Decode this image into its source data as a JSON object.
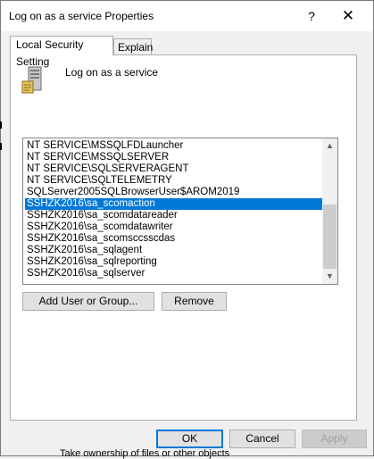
{
  "dialog": {
    "title": "Log on as a service Properties",
    "help_glyph": "?",
    "close_glyph": "✕"
  },
  "tabs": [
    {
      "label": "Local Security Setting",
      "active": true
    },
    {
      "label": "Explain",
      "active": false
    }
  ],
  "policy": {
    "name": "Log on as a service",
    "icon": "server-policy-icon"
  },
  "accounts": {
    "items": [
      "NT SERVICE\\MSSQLFDLauncher",
      "NT SERVICE\\MSSQLSERVER",
      "NT SERVICE\\SQLSERVERAGENT",
      "NT SERVICE\\SQLTELEMETRY",
      "SQLServer2005SQLBrowserUser$AROM2019",
      "SSHZK2016\\sa_scomaction",
      "SSHZK2016\\sa_scomdatareader",
      "SSHZK2016\\sa_scomdatawriter",
      "SSHZK2016\\sa_scomsccsscdas",
      "SSHZK2016\\sa_sqlagent",
      "SSHZK2016\\sa_sqlreporting",
      "SSHZK2016\\sa_sqlserver"
    ],
    "selected_index": 5
  },
  "buttons": {
    "add": "Add User or Group...",
    "remove": "Remove",
    "ok": "OK",
    "cancel": "Cancel",
    "apply": "Apply"
  },
  "background_text": "Take ownership of files or other objects",
  "colors": {
    "selection": "#0078d7",
    "accent_border": "#0078d7"
  }
}
